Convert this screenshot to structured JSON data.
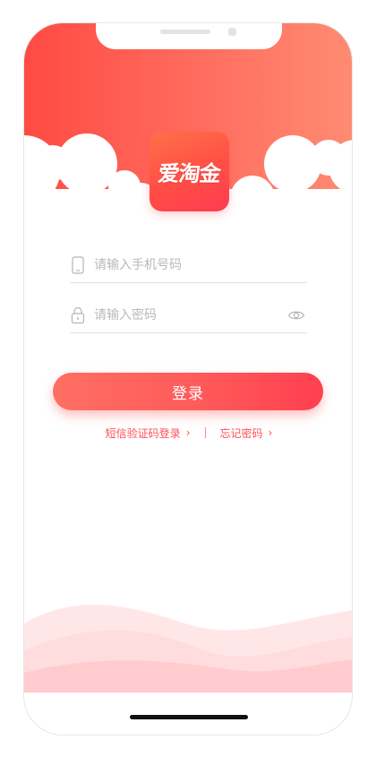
{
  "app": {
    "logo_text": "爱淘金"
  },
  "form": {
    "phone_placeholder": "请输入手机号码",
    "phone_value": "",
    "password_placeholder": "请输入密码",
    "password_value": ""
  },
  "actions": {
    "login_label": "登录",
    "sms_login_label": "短信验证码登录",
    "forgot_password_label": "忘记密码",
    "chevron": "›"
  },
  "icons": {
    "phone": "phone-icon",
    "lock": "lock-icon",
    "eye": "eye-icon",
    "chevron": "chevron-right-icon"
  },
  "colors": {
    "accent": "#ff4e55",
    "header_start": "#ff4a42",
    "header_end": "#ff8b72",
    "wave": "#ffd6d8"
  }
}
